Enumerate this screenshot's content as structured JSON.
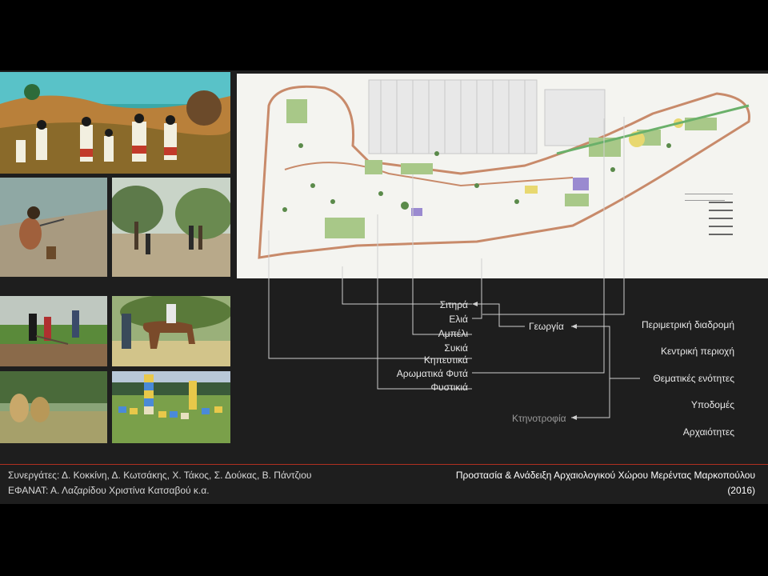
{
  "left_photos": [
    {
      "name": "folk-painting-harvest",
      "desc": "painting"
    },
    {
      "name": "photo-seashore-figure"
    },
    {
      "name": "photo-olive-grove"
    },
    {
      "name": "photo-ploughing"
    },
    {
      "name": "photo-horse-rider"
    },
    {
      "name": "photo-hay-bales"
    },
    {
      "name": "photo-beehives"
    }
  ],
  "crops": [
    "Σιτηρά",
    "Ελιά",
    "Αμπέλι",
    "Συκιά",
    "Κηπευτικά",
    "Αρωματικά Φυτά",
    "Φυστικιά"
  ],
  "categories": {
    "agriculture": "Γεωργία",
    "livestock": "Κτηνοτροφία"
  },
  "themes": [
    "Περιμετρική διαδρομή",
    "Κεντρική περιοχή",
    "Θεματικές ενότητες",
    "Υποδομές",
    "Αρχαιότητες"
  ],
  "footer": {
    "collaborators": "Συνεργάτες: Δ. Κοκκίνη, Δ. Κωτσάκης, Χ. Τάκος, Σ. Δούκας, Β. Πάντζιου",
    "efanat": "ΕΦΑΝΑΤ:  Α. Λαζαρίδου Χριστίνα Κατσαβού κ.α.",
    "project_title": "Προστασία & Ανάδειξη Αρχαιολογικού Χώρου Μερέντας Μαρκοπούλου",
    "year": "(2016)"
  },
  "colors": {
    "accent_line": "#b03020",
    "connector": "#cfcfcf",
    "background": "#1e1e1e"
  }
}
